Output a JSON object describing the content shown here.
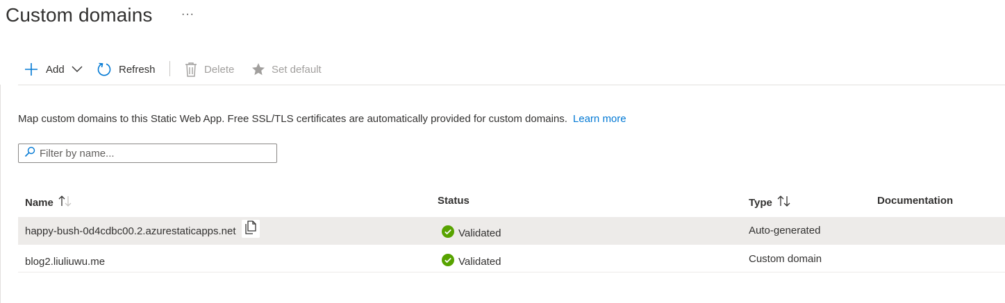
{
  "header": {
    "title": "Custom domains",
    "more_label": "···"
  },
  "toolbar": {
    "add_label": "Add",
    "refresh_label": "Refresh",
    "delete_label": "Delete",
    "set_default_label": "Set default"
  },
  "info": {
    "text": "Map custom domains to this Static Web App. Free SSL/TLS certificates are automatically provided for custom domains.",
    "learn_more_label": "Learn more"
  },
  "filter": {
    "placeholder": "Filter by name...",
    "value": ""
  },
  "table": {
    "columns": {
      "name": "Name",
      "status": "Status",
      "type": "Type",
      "documentation": "Documentation"
    },
    "rows": [
      {
        "name": "happy-bush-0d4cdbc00.2.azurestaticapps.net",
        "status": "Validated",
        "type": "Auto-generated",
        "documentation": ""
      },
      {
        "name": "blog2.liuliuwu.me",
        "status": "Validated",
        "type": "Custom domain",
        "documentation": ""
      }
    ]
  },
  "colors": {
    "accent": "#0078d4",
    "success": "#57a300",
    "disabled": "#a19f9d",
    "selected_row": "#edebe9"
  },
  "icons": {
    "add": "plus-icon",
    "add_dropdown": "chevron-down-icon",
    "refresh": "refresh-icon",
    "delete": "trash-icon",
    "set_default": "star-icon",
    "filter": "search-icon",
    "copy": "copy-icon",
    "status": "check-circle-icon",
    "sort": "sort-arrows-icon"
  }
}
